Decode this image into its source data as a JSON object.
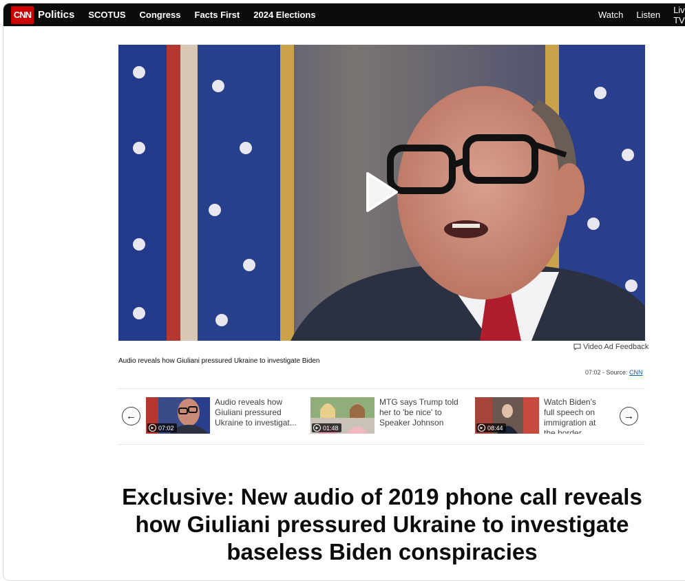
{
  "nav": {
    "logo": "CNN",
    "section": "Politics",
    "links": [
      "SCOTUS",
      "Congress",
      "Facts First",
      "2024 Elections"
    ],
    "right_links": [
      "Watch",
      "Listen",
      "Live TV"
    ]
  },
  "player": {
    "ad_feedback": "Video Ad Feedback",
    "caption": "Audio reveals how Giuliani pressured Ukraine to investigate Biden",
    "duration_source_prefix": "07:02 - Source: ",
    "source_link": "CNN"
  },
  "carousel": {
    "prev_icon": "←",
    "next_icon": "→",
    "items": [
      {
        "duration": "07:02",
        "title": "Audio reveals how Giuliani pressured Ukraine to investigat..."
      },
      {
        "duration": "01:48",
        "title": "MTG says Trump told her to 'be nice' to Speaker Johnson"
      },
      {
        "duration": "08:44",
        "title": "Watch Biden's full speech on immigration at the border"
      }
    ]
  },
  "headline": "Exclusive: New audio of 2019 phone call reveals how Giuliani pressured Ukraine to investigate baseless Biden conspiracies",
  "colors": {
    "brand": "#cc0000",
    "nav_bg": "#0c0c0c",
    "link": "#0b5fa5"
  }
}
